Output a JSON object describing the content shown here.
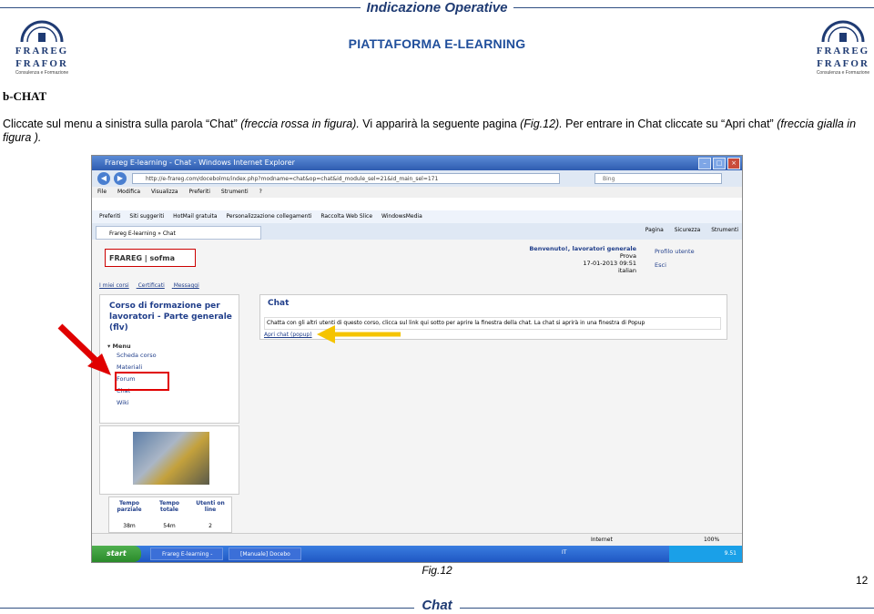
{
  "header": {
    "title": "Indicazione Operative",
    "subtitle": "PIATTAFORMA E-LEARNING",
    "logo_text_1": "FRAREG",
    "logo_text_2": "FRAFOR",
    "logo_small": "Consulenza e Formazione"
  },
  "section": {
    "title": "b-CHAT"
  },
  "paragraph": {
    "part1": "Cliccate sul menu a sinistra sulla parola “Chat” ",
    "part2": "(freccia rossa in figura).",
    "part3": " Vi apparirà la seguente pagina ",
    "part4": "(Fig.12).",
    "part5": " Per entrare in Chat cliccate su “Apri chat” ",
    "part6": "(freccia gialla in figura )."
  },
  "screenshot": {
    "window_title": "Frareg E-learning - Chat - Windows Internet Explorer",
    "address": "http://e-frareg.com/docebolms/index.php?modname=chat&op=chat&id_module_sel=21&id_main_sel=171",
    "search_placeholder": "Bing",
    "menu": [
      "File",
      "Modifica",
      "Visualizza",
      "Preferiti",
      "Strumenti",
      "?"
    ],
    "favorites": [
      "Preferiti",
      "Siti suggeriti",
      "HotMail gratuita",
      "Personalizzazione collegamenti",
      "Raccolta Web Slice",
      "WindowsMedia"
    ],
    "tab_label": "Frareg E-learning » Chat",
    "commands": [
      "Pagina",
      "Sicurezza",
      "Strumenti"
    ],
    "lms_logo": "FRAREG | sofma",
    "welcome": {
      "line1": "Benvenuto!, lavoratori generale",
      "line2": "Prova",
      "line3": "17-01-2013 09:51",
      "line4": "italian"
    },
    "profile": [
      "Profilo utente",
      "Esci"
    ],
    "top_links": [
      "I miei corsi",
      "Certificati",
      "Messaggi"
    ],
    "course_title": "Corso di formazione per lavoratori - Parte generale (flv)",
    "menu_header": "Menu",
    "menu_items": [
      "Scheda corso",
      "Materiali",
      "Forum",
      "Chat",
      "Wiki"
    ],
    "stats": {
      "headers": [
        "Tempo parziale",
        "Tempo totale",
        "Utenti on line"
      ],
      "values": [
        "38m",
        "54m",
        "2"
      ]
    },
    "chat": {
      "title": "Chat",
      "description": "Chatta con gli altri utenti di questo corso, clicca sul link qui sotto per aprire la finestra della chat. La chat si aprirà in una finestra di Popup",
      "link": "Apri chat (popup)"
    },
    "status": {
      "zone": "Internet",
      "zoom": "100%"
    },
    "taskbar": {
      "start": "start",
      "tasks": [
        "Frareg E-learning - C...",
        "[Manuale] Docebo pr..."
      ],
      "lang": "IT",
      "time": "9.51"
    },
    "colors": {
      "red_arrow": "#e00000",
      "yellow_arrow": "#f5c400"
    }
  },
  "figure": {
    "caption": "Fig.12"
  },
  "footer": {
    "page_number": "12",
    "title": "Chat"
  }
}
